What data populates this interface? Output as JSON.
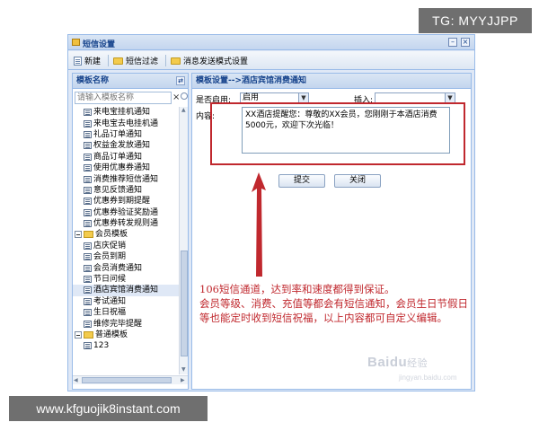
{
  "watermark_top": "TG: MYYJJPP",
  "watermark_bottom": "www.kfguojik8instant.com",
  "window": {
    "title": "短信设置",
    "controls": [
      "–",
      "×"
    ]
  },
  "toolbar": {
    "new_label": "新建",
    "filter_label": "短信过滤",
    "mode_label": "消息发送模式设置"
  },
  "left": {
    "title": "模板名称",
    "search_placeholder": "请输入模板名称",
    "clear": "×",
    "tree": [
      {
        "label": "来电宝挂机通知",
        "type": "item"
      },
      {
        "label": "来电宝去电挂机通",
        "type": "item"
      },
      {
        "label": "礼品订单通知",
        "type": "item"
      },
      {
        "label": "权益金发放通知",
        "type": "item"
      },
      {
        "label": "商品订单通知",
        "type": "item"
      },
      {
        "label": "使用优惠券通知",
        "type": "item"
      },
      {
        "label": "消费推荐短信通知",
        "type": "item"
      },
      {
        "label": "意见反馈通知",
        "type": "item"
      },
      {
        "label": "优惠券到期提醒",
        "type": "item"
      },
      {
        "label": "优惠券验证奖励通",
        "type": "item"
      },
      {
        "label": "优惠券转发规则通",
        "type": "item"
      },
      {
        "label": "会员模板",
        "type": "folder"
      },
      {
        "label": "店庆促销",
        "type": "item"
      },
      {
        "label": "会员到期",
        "type": "item"
      },
      {
        "label": "会员消费通知",
        "type": "item"
      },
      {
        "label": "节日问候",
        "type": "item"
      },
      {
        "label": "酒店宾馆消费通知",
        "type": "item",
        "selected": true
      },
      {
        "label": "考试通知",
        "type": "item"
      },
      {
        "label": "生日祝福",
        "type": "item"
      },
      {
        "label": "维修完毕提醒",
        "type": "item"
      },
      {
        "label": "普通模板",
        "type": "folder"
      },
      {
        "label": "123",
        "type": "item"
      }
    ]
  },
  "form": {
    "title": "模板设置-->酒店宾馆消费通知",
    "enabled_label": "是否启用:",
    "enabled_value": "启用",
    "insert_label": "插入:",
    "insert_value": "",
    "content_label": "内容:",
    "content_value": "XX酒店提醒您：尊敬的XX会员，您刚刚于本酒店消费5000元，欢迎下次光临！",
    "submit_label": "提交",
    "close_label": "关闭"
  },
  "annotation": {
    "line1": "106短信通道，达到率和速度都得到保证。",
    "line2": "会员等级、消费、充值等都会有短信通知，会员生日节假日等也能定时收到短信祝福，以上内容都可自定义编辑。"
  },
  "baidu_watermark": {
    "brand": "Baidu",
    "cn": "经验",
    "sub": "jingyan.baidu.com"
  },
  "colors": {
    "highlight": "#c0282e",
    "panel_border": "#99bbe8",
    "header_text": "#15428b"
  }
}
